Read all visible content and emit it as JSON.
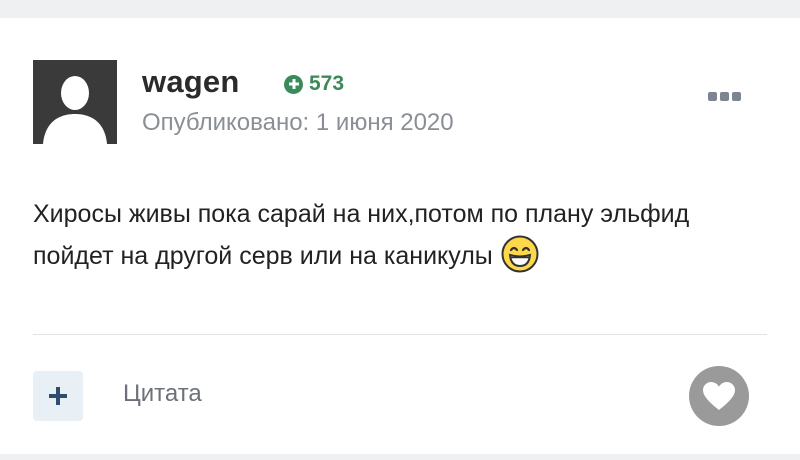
{
  "post": {
    "author": "wagen",
    "reputation": "573",
    "published": "Опубликовано: 1 июня 2020",
    "content": "Хиросы живы пока сарай на них,потом по плану эльфид пойдет на другой серв или на каникулы",
    "emoji": "grinning-face-emoji"
  },
  "actions": {
    "quote_label": "Цитата",
    "add_icon": "plus-icon",
    "like_icon": "heart-icon",
    "more_icon": "more-options-icon"
  },
  "colors": {
    "reputation": "#3b8a5a",
    "like_button": "#9a9a9a",
    "add_button_bg": "#e8f0f6"
  }
}
